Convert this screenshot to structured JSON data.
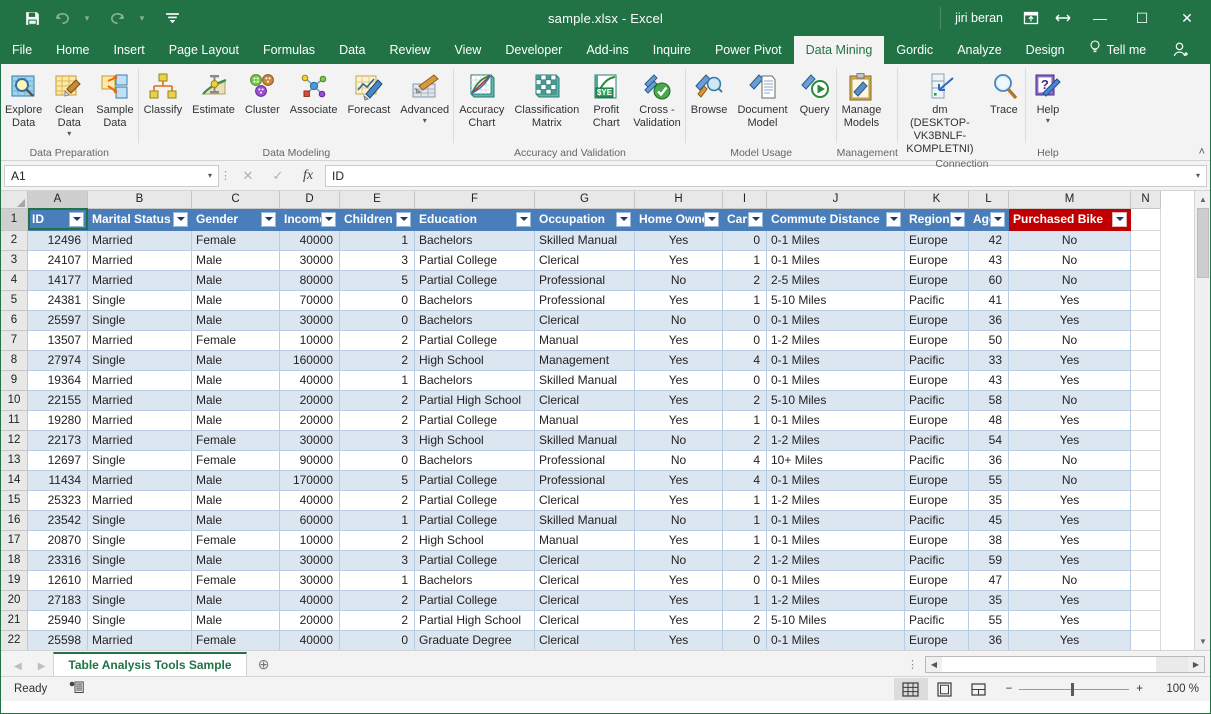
{
  "titlebar": {
    "quick_access": [
      {
        "name": "save-icon",
        "label": "Save"
      },
      {
        "name": "undo-icon",
        "label": "Undo"
      },
      {
        "name": "redo-icon",
        "label": "Redo"
      },
      {
        "name": "customize-qat-icon",
        "label": "Customize Quick Access Toolbar"
      }
    ],
    "title": "sample.xlsx  -  Excel",
    "account": "jiri beran",
    "ribbon_display_options": "ribbon-display-icon",
    "restore_down": "restore-icon",
    "minimize": "—",
    "maximize": "☐",
    "close": "✕"
  },
  "tabs": [
    {
      "label": "File",
      "active": false
    },
    {
      "label": "Home",
      "active": false
    },
    {
      "label": "Insert",
      "active": false
    },
    {
      "label": "Page Layout",
      "active": false
    },
    {
      "label": "Formulas",
      "active": false
    },
    {
      "label": "Data",
      "active": false
    },
    {
      "label": "Review",
      "active": false
    },
    {
      "label": "View",
      "active": false
    },
    {
      "label": "Developer",
      "active": false
    },
    {
      "label": "Add-ins",
      "active": false
    },
    {
      "label": "Inquire",
      "active": false
    },
    {
      "label": "Power Pivot",
      "active": false
    },
    {
      "label": "Data Mining",
      "active": true
    },
    {
      "label": "Gordic",
      "active": false
    },
    {
      "label": "Analyze",
      "active": false
    },
    {
      "label": "Design",
      "active": false
    }
  ],
  "tellme": "Tell me",
  "ribbon": {
    "groups": [
      {
        "title": "Data Preparation",
        "commands": [
          {
            "label": "Explore\nData",
            "icon": "explore-data-icon",
            "caret": false
          },
          {
            "label": "Clean\nData",
            "icon": "clean-data-icon",
            "caret": true
          },
          {
            "label": "Sample\nData",
            "icon": "sample-data-icon",
            "caret": false
          }
        ]
      },
      {
        "title": "Data Modeling",
        "commands": [
          {
            "label": "Classify",
            "icon": "classify-icon",
            "caret": false
          },
          {
            "label": "Estimate",
            "icon": "estimate-icon",
            "caret": false
          },
          {
            "label": "Cluster",
            "icon": "cluster-icon",
            "caret": false
          },
          {
            "label": "Associate",
            "icon": "associate-icon",
            "caret": false
          },
          {
            "label": "Forecast",
            "icon": "forecast-icon",
            "caret": false
          },
          {
            "label": "Advanced",
            "icon": "advanced-icon",
            "caret": true
          }
        ]
      },
      {
        "title": "Accuracy and Validation",
        "commands": [
          {
            "label": "Accuracy\nChart",
            "icon": "accuracy-chart-icon",
            "caret": false
          },
          {
            "label": "Classification\nMatrix",
            "icon": "classification-matrix-icon",
            "caret": false
          },
          {
            "label": "Profit\nChart",
            "icon": "profit-chart-icon",
            "caret": false
          },
          {
            "label": "Cross -\nValidation",
            "icon": "cross-validation-icon",
            "caret": false
          }
        ]
      },
      {
        "title": "Model Usage",
        "commands": [
          {
            "label": "Browse",
            "icon": "browse-icon",
            "caret": false
          },
          {
            "label": "Document\nModel",
            "icon": "document-model-icon",
            "caret": false
          },
          {
            "label": "Query",
            "icon": "query-icon",
            "caret": false
          }
        ]
      },
      {
        "title": "Management",
        "commands": [
          {
            "label": "Manage\nModels",
            "icon": "manage-models-icon",
            "caret": false
          }
        ]
      },
      {
        "title": "Connection",
        "commands": [
          {
            "label": "dm (DESKTOP-\nVK3BNLF-KOMPLETNI)",
            "icon": "connection-icon",
            "caret": false
          },
          {
            "label": "Trace",
            "icon": "trace-icon",
            "caret": false
          }
        ]
      },
      {
        "title": "Help",
        "commands": [
          {
            "label": "Help",
            "icon": "help-icon",
            "caret": true
          }
        ]
      }
    ],
    "collapse_label": "˄"
  },
  "formula_bar": {
    "name_box": "A1",
    "cancel": "✕",
    "enter": "✓",
    "fx": "fx",
    "content": "ID"
  },
  "grid": {
    "column_letters": [
      "A",
      "B",
      "C",
      "D",
      "E",
      "F",
      "G",
      "H",
      "I",
      "J",
      "K",
      "L",
      "M",
      "N"
    ],
    "selected_column": "A",
    "selected_row": "1",
    "headers": [
      {
        "label": "ID",
        "accent": "blue"
      },
      {
        "label": "Marital Status",
        "accent": "blue"
      },
      {
        "label": "Gender",
        "accent": "blue"
      },
      {
        "label": "Income",
        "accent": "blue"
      },
      {
        "label": "Children",
        "accent": "blue"
      },
      {
        "label": "Education",
        "accent": "blue"
      },
      {
        "label": "Occupation",
        "accent": "blue"
      },
      {
        "label": "Home Owner",
        "accent": "blue"
      },
      {
        "label": "Cars",
        "accent": "blue"
      },
      {
        "label": "Commute Distance",
        "accent": "blue"
      },
      {
        "label": "Region",
        "accent": "blue"
      },
      {
        "label": "Age",
        "accent": "blue"
      },
      {
        "label": "Purchased Bike",
        "accent": "red"
      }
    ],
    "row_numbers": [
      "1",
      "2",
      "3",
      "4",
      "5",
      "6",
      "7",
      "8",
      "9",
      "10",
      "11",
      "12",
      "13",
      "14",
      "15",
      "16",
      "17",
      "18",
      "19",
      "20",
      "21",
      "22"
    ],
    "rows": [
      [
        "12496",
        "Married",
        "Female",
        "40000",
        "1",
        "Bachelors",
        "Skilled Manual",
        "Yes",
        "0",
        "0-1 Miles",
        "Europe",
        "42",
        "No"
      ],
      [
        "24107",
        "Married",
        "Male",
        "30000",
        "3",
        "Partial College",
        "Clerical",
        "Yes",
        "1",
        "0-1 Miles",
        "Europe",
        "43",
        "No"
      ],
      [
        "14177",
        "Married",
        "Male",
        "80000",
        "5",
        "Partial College",
        "Professional",
        "No",
        "2",
        "2-5 Miles",
        "Europe",
        "60",
        "No"
      ],
      [
        "24381",
        "Single",
        "Male",
        "70000",
        "0",
        "Bachelors",
        "Professional",
        "Yes",
        "1",
        "5-10 Miles",
        "Pacific",
        "41",
        "Yes"
      ],
      [
        "25597",
        "Single",
        "Male",
        "30000",
        "0",
        "Bachelors",
        "Clerical",
        "No",
        "0",
        "0-1 Miles",
        "Europe",
        "36",
        "Yes"
      ],
      [
        "13507",
        "Married",
        "Female",
        "10000",
        "2",
        "Partial College",
        "Manual",
        "Yes",
        "0",
        "1-2 Miles",
        "Europe",
        "50",
        "No"
      ],
      [
        "27974",
        "Single",
        "Male",
        "160000",
        "2",
        "High School",
        "Management",
        "Yes",
        "4",
        "0-1 Miles",
        "Pacific",
        "33",
        "Yes"
      ],
      [
        "19364",
        "Married",
        "Male",
        "40000",
        "1",
        "Bachelors",
        "Skilled Manual",
        "Yes",
        "0",
        "0-1 Miles",
        "Europe",
        "43",
        "Yes"
      ],
      [
        "22155",
        "Married",
        "Male",
        "20000",
        "2",
        "Partial High School",
        "Clerical",
        "Yes",
        "2",
        "5-10 Miles",
        "Pacific",
        "58",
        "No"
      ],
      [
        "19280",
        "Married",
        "Male",
        "20000",
        "2",
        "Partial College",
        "Manual",
        "Yes",
        "1",
        "0-1 Miles",
        "Europe",
        "48",
        "Yes"
      ],
      [
        "22173",
        "Married",
        "Female",
        "30000",
        "3",
        "High School",
        "Skilled Manual",
        "No",
        "2",
        "1-2 Miles",
        "Pacific",
        "54",
        "Yes"
      ],
      [
        "12697",
        "Single",
        "Female",
        "90000",
        "0",
        "Bachelors",
        "Professional",
        "No",
        "4",
        "10+ Miles",
        "Pacific",
        "36",
        "No"
      ],
      [
        "11434",
        "Married",
        "Male",
        "170000",
        "5",
        "Partial College",
        "Professional",
        "Yes",
        "4",
        "0-1 Miles",
        "Europe",
        "55",
        "No"
      ],
      [
        "25323",
        "Married",
        "Male",
        "40000",
        "2",
        "Partial College",
        "Clerical",
        "Yes",
        "1",
        "1-2 Miles",
        "Europe",
        "35",
        "Yes"
      ],
      [
        "23542",
        "Single",
        "Male",
        "60000",
        "1",
        "Partial College",
        "Skilled Manual",
        "No",
        "1",
        "0-1 Miles",
        "Pacific",
        "45",
        "Yes"
      ],
      [
        "20870",
        "Single",
        "Female",
        "10000",
        "2",
        "High School",
        "Manual",
        "Yes",
        "1",
        "0-1 Miles",
        "Europe",
        "38",
        "Yes"
      ],
      [
        "23316",
        "Single",
        "Male",
        "30000",
        "3",
        "Partial College",
        "Clerical",
        "No",
        "2",
        "1-2 Miles",
        "Pacific",
        "59",
        "Yes"
      ],
      [
        "12610",
        "Married",
        "Female",
        "30000",
        "1",
        "Bachelors",
        "Clerical",
        "Yes",
        "0",
        "0-1 Miles",
        "Europe",
        "47",
        "No"
      ],
      [
        "27183",
        "Single",
        "Male",
        "40000",
        "2",
        "Partial College",
        "Clerical",
        "Yes",
        "1",
        "1-2 Miles",
        "Europe",
        "35",
        "Yes"
      ],
      [
        "25940",
        "Single",
        "Male",
        "20000",
        "2",
        "Partial High School",
        "Clerical",
        "Yes",
        "2",
        "5-10 Miles",
        "Pacific",
        "55",
        "Yes"
      ],
      [
        "25598",
        "Married",
        "Female",
        "40000",
        "0",
        "Graduate Degree",
        "Clerical",
        "Yes",
        "0",
        "0-1 Miles",
        "Europe",
        "36",
        "Yes"
      ]
    ]
  },
  "sheet_bar": {
    "first_label": "◀",
    "prev_label": "◀",
    "next_label": "▶",
    "sheets": [
      {
        "label": "Table Analysis Tools Sample",
        "active": true
      }
    ],
    "add_sheet": "⊕"
  },
  "status_bar": {
    "state": "Ready",
    "macro_record": "record-macro-icon",
    "views": [
      {
        "name": "normal-view",
        "glyph": "⊞",
        "active": true
      },
      {
        "name": "page-layout-view",
        "glyph": "▤",
        "active": false
      },
      {
        "name": "page-break-preview",
        "glyph": "▥",
        "active": false
      }
    ],
    "zoom_out": "−",
    "zoom_in": "+",
    "zoom_level": "100 %"
  },
  "colors": {
    "brand_green": "#217346",
    "table_header_blue": "#4a7ebb",
    "table_header_red": "#c00000",
    "band_blue": "#dce6f1"
  }
}
